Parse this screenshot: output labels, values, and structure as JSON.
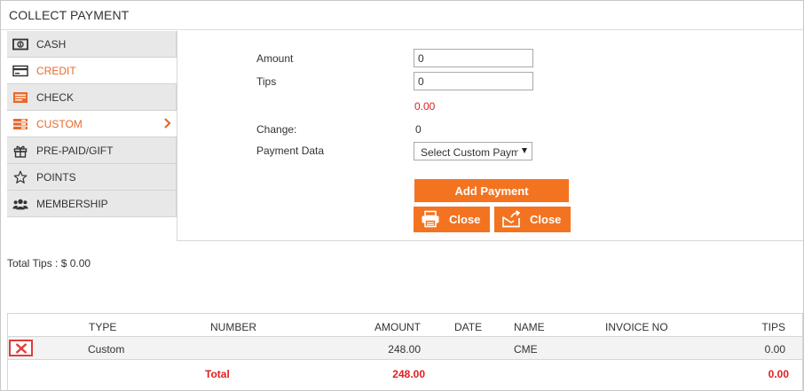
{
  "header": {
    "title": "COLLECT PAYMENT"
  },
  "sidebar": {
    "items": [
      {
        "label": "CASH",
        "icon": "cash-icon"
      },
      {
        "label": "CREDIT",
        "icon": "credit-card-icon"
      },
      {
        "label": "CHECK",
        "icon": "check-icon"
      },
      {
        "label": "CUSTOM",
        "icon": "custom-icon"
      },
      {
        "label": "PRE-PAID/GIFT",
        "icon": "gift-icon"
      },
      {
        "label": "POINTS",
        "icon": "star-icon"
      },
      {
        "label": "MEMBERSHIP",
        "icon": "members-icon"
      }
    ],
    "active": "CUSTOM"
  },
  "form": {
    "amount_label": "Amount",
    "amount_value": "0",
    "tips_label": "Tips",
    "tips_value": "0",
    "tips_computed": "0.00",
    "change_label": "Change:",
    "change_value": "0",
    "payment_data_label": "Payment Data",
    "payment_data_selected": "Select Custom Payment"
  },
  "buttons": {
    "add_payment": "Add Payment",
    "close_print": "Close",
    "close_email": "Close"
  },
  "summary": {
    "total_tips": "Total Tips : $ 0.00"
  },
  "table": {
    "headers": {
      "type": "TYPE",
      "number": "NUMBER",
      "amount": "AMOUNT",
      "date": "DATE",
      "name": "NAME",
      "invoice_no": "INVOICE NO",
      "tips": "TIPS"
    },
    "rows": [
      {
        "type": "Custom",
        "number": "",
        "amount": "248.00",
        "date": "",
        "name": "CME",
        "invoice_no": "",
        "tips": "0.00"
      }
    ],
    "footer": {
      "label": "Total",
      "amount": "248.00",
      "tips": "0.00"
    }
  },
  "colors": {
    "accent": "#f47321",
    "active_text": "#e8692b",
    "error_red": "#e02020",
    "sidebar_bg": "#e8e8e8"
  }
}
